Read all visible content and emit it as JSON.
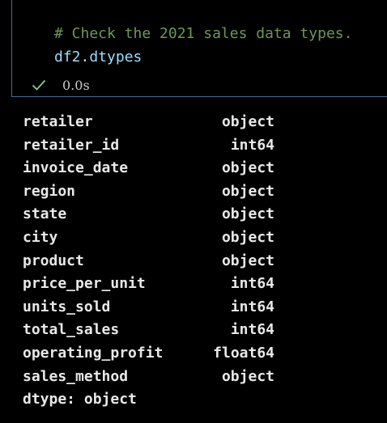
{
  "code_cell": {
    "comment": "# Check the 2021 sales data types.",
    "variable": "df2",
    "dot": ".",
    "attribute": "dtypes",
    "status_icon": "check-icon",
    "exec_time": "0.0s"
  },
  "output": {
    "rows": [
      {
        "name": "retailer",
        "dtype": "object"
      },
      {
        "name": "retailer_id",
        "dtype": "int64"
      },
      {
        "name": "invoice_date",
        "dtype": "object"
      },
      {
        "name": "region",
        "dtype": "object"
      },
      {
        "name": "state",
        "dtype": "object"
      },
      {
        "name": "city",
        "dtype": "object"
      },
      {
        "name": "product",
        "dtype": "object"
      },
      {
        "name": "price_per_unit",
        "dtype": "int64"
      },
      {
        "name": "units_sold",
        "dtype": "int64"
      },
      {
        "name": "total_sales",
        "dtype": "int64"
      },
      {
        "name": "operating_profit",
        "dtype": "float64"
      },
      {
        "name": "sales_method",
        "dtype": "object"
      }
    ],
    "footer": "dtype: object"
  },
  "colors": {
    "comment": "#6a9955",
    "variable": "#9cdcfe",
    "check": "#89d185",
    "cell_border": "#3c6e9c"
  }
}
